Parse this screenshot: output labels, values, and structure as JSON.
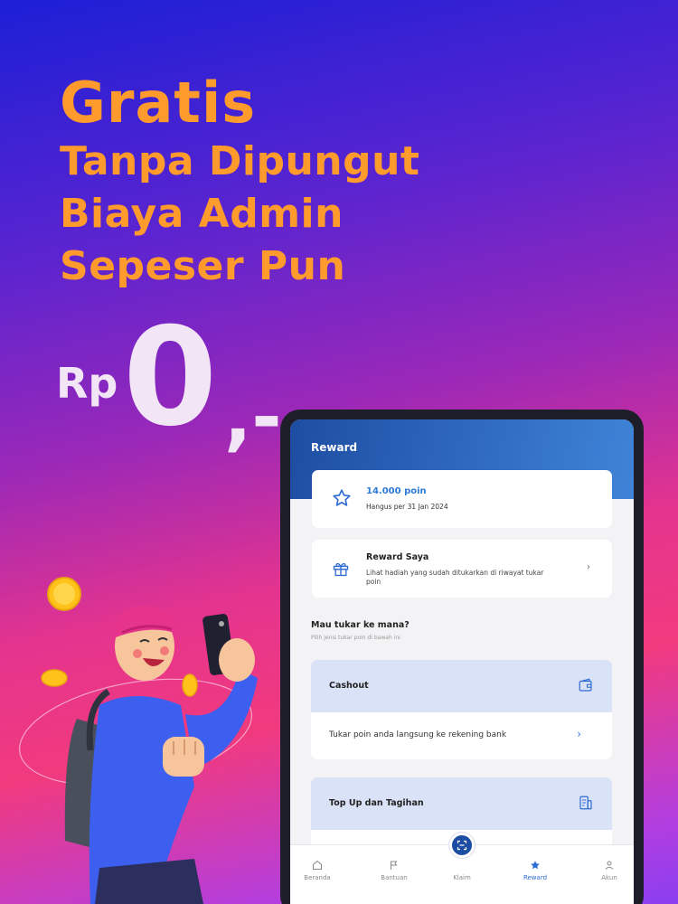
{
  "headline": {
    "title": "Gratis",
    "line1": "Tanpa Dipungut",
    "line2": "Biaya Admin",
    "line3": "Sepeser Pun"
  },
  "price": {
    "currency": "Rp",
    "amount": "0",
    "suffix": ",-"
  },
  "app": {
    "header_title": "Reward",
    "points": {
      "value": "14.000 poin",
      "expiry": "Hangus per 31 Jan 2024",
      "icon": "star-icon"
    },
    "reward_saya": {
      "title": "Reward Saya",
      "desc": "Lihat hadiah yang sudah ditukarkan di riwayat tukar poin",
      "icon": "gift-icon"
    },
    "section": {
      "title": "Mau tukar ke mana?",
      "subtitle": "Pilih jenis tukar poin di bawah ini"
    },
    "options": [
      {
        "title": "Cashout",
        "desc": "Tukar poin anda langsung ke rekening bank",
        "icon": "wallet-icon"
      },
      {
        "title": "Top Up dan Tagihan",
        "desc": "",
        "icon": "bill-icon"
      }
    ],
    "nav": [
      {
        "label": "Beranda",
        "icon": "home-icon"
      },
      {
        "label": "Bantuan",
        "icon": "flag-icon"
      },
      {
        "label": "Klaim",
        "icon": "scan-icon"
      },
      {
        "label": "Reward",
        "icon": "star-icon",
        "active": true
      },
      {
        "label": "Akun",
        "icon": "person-icon"
      }
    ]
  },
  "colors": {
    "headline": "#ff9a2c",
    "accent_blue": "#2d7ad8",
    "header_start": "#1d4da3",
    "header_end": "#3f84d8",
    "option_bg": "#d9e2f7"
  }
}
